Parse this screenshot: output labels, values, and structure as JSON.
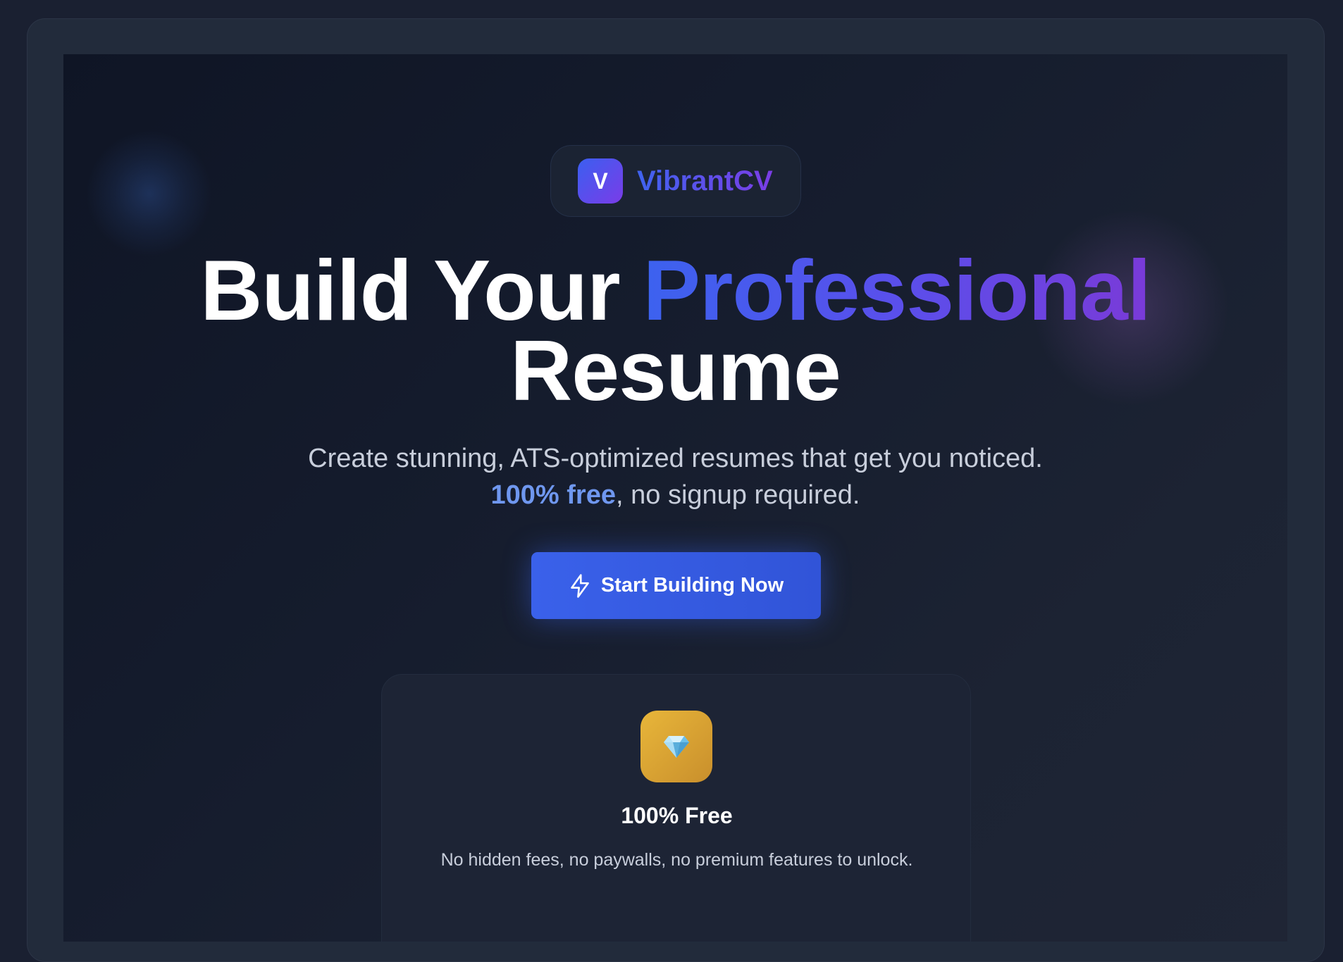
{
  "brand": {
    "logo_letter": "V",
    "name": "VibrantCV"
  },
  "hero": {
    "title_part1": "Build Your ",
    "title_accent": "Professional",
    "title_part2": "Resume"
  },
  "subtitle": {
    "line1": "Create stunning, ATS-optimized resumes that get you noticed.",
    "highlight": "100% free",
    "line2_rest": ", no signup required."
  },
  "cta": {
    "label": "Start Building Now",
    "icon": "lightning-icon"
  },
  "feature": {
    "icon": "diamond-icon",
    "title": "100% Free",
    "description": "No hidden fees, no paywalls, no premium features to unlock."
  },
  "colors": {
    "background": "#1a2031",
    "accent_blue": "#3a61ea",
    "accent_purple": "#7a3ce8",
    "highlight_blue": "#6f97ef",
    "gold": "#e8b63a"
  }
}
